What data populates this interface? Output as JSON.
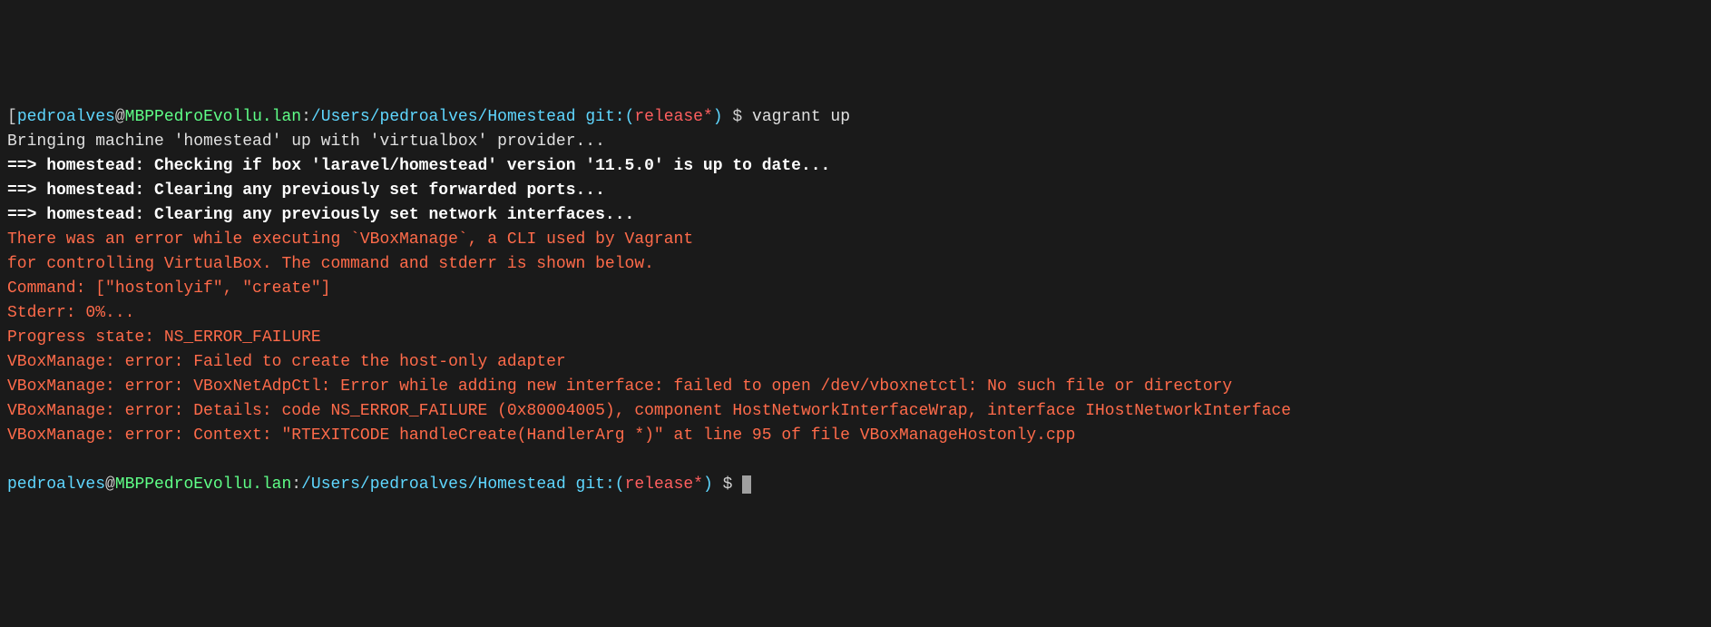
{
  "prompt1": {
    "bracket_open": "[",
    "user": "pedroalves",
    "at": "@",
    "host": "MBPPedroEvollu.lan",
    "colon": ":",
    "path": "/Users/pedroalves/Homestead",
    "git_label": " git:(",
    "branch": "release*",
    "git_close": ")",
    "dollar": " $ ",
    "command": "vagrant up"
  },
  "output": {
    "line1": "Bringing machine 'homestead' up with 'virtualbox' provider...",
    "line2": "==> homestead: Checking if box 'laravel/homestead' version '11.5.0' is up to date...",
    "line3": "==> homestead: Clearing any previously set forwarded ports...",
    "line4": "==> homestead: Clearing any previously set network interfaces...",
    "err1": "There was an error while executing `VBoxManage`, a CLI used by Vagrant",
    "err2": "for controlling VirtualBox. The command and stderr is shown below.",
    "err3": "",
    "err4": "Command: [\"hostonlyif\", \"create\"]",
    "err5": "",
    "err6": "Stderr: 0%...",
    "err7": "Progress state: NS_ERROR_FAILURE",
    "err8": "VBoxManage: error: Failed to create the host-only adapter",
    "err9": "VBoxManage: error: VBoxNetAdpCtl: Error while adding new interface: failed to open /dev/vboxnetctl: No such file or directory",
    "err10": "VBoxManage: error: Details: code NS_ERROR_FAILURE (0x80004005), component HostNetworkInterfaceWrap, interface IHostNetworkInterface",
    "err11": "VBoxManage: error: Context: \"RTEXITCODE handleCreate(HandlerArg *)\" at line 95 of file VBoxManageHostonly.cpp"
  },
  "prompt2": {
    "user": "pedroalves",
    "at": "@",
    "host": "MBPPedroEvollu.lan",
    "colon": ":",
    "path": "/Users/pedroalves/Homestead",
    "git_label": " git:(",
    "branch": "release*",
    "git_close": ")",
    "dollar": " $ "
  }
}
